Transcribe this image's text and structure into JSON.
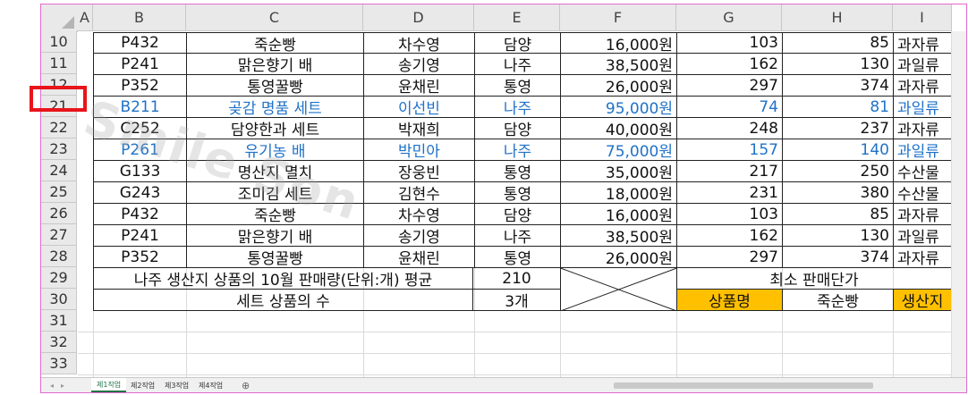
{
  "columns": [
    "A",
    "B",
    "C",
    "D",
    "E",
    "F",
    "G",
    "H",
    "I"
  ],
  "rows": [
    {
      "num": "10",
      "b": "P432",
      "c": "죽순빵",
      "d": "차수영",
      "e": "담양",
      "f": "16,000원",
      "g": "103",
      "h": "85",
      "i": "과자류"
    },
    {
      "num": "11",
      "b": "P241",
      "c": "맑은향기 배",
      "d": "송기영",
      "e": "나주",
      "f": "38,500원",
      "g": "162",
      "h": "130",
      "i": "과일류"
    },
    {
      "num": "12",
      "b": "P352",
      "c": "통영꿀빵",
      "d": "윤채린",
      "e": "통영",
      "f": "26,000원",
      "g": "297",
      "h": "374",
      "i": "과자류"
    },
    {
      "num": "21",
      "b": "B211",
      "c": "곶감 명품 세트",
      "d": "이선빈",
      "e": "나주",
      "f": "95,000원",
      "g": "74",
      "h": "81",
      "i": "과일류",
      "highlight": true
    },
    {
      "num": "22",
      "b": "C252",
      "c": "담양한과 세트",
      "d": "박재희",
      "e": "담양",
      "f": "40,000원",
      "g": "248",
      "h": "237",
      "i": "과자류"
    },
    {
      "num": "23",
      "b": "P261",
      "c": "유기농 배",
      "d": "박민아",
      "e": "나주",
      "f": "75,000원",
      "g": "157",
      "h": "140",
      "i": "과일류",
      "highlight": true
    },
    {
      "num": "24",
      "b": "G133",
      "c": "명산지 멸치",
      "d": "장웅빈",
      "e": "통영",
      "f": "35,000원",
      "g": "217",
      "h": "250",
      "i": "수산물"
    },
    {
      "num": "25",
      "b": "G243",
      "c": "조미김 세트",
      "d": "김현수",
      "e": "통영",
      "f": "18,000원",
      "g": "231",
      "h": "380",
      "i": "수산물"
    },
    {
      "num": "26",
      "b": "P432",
      "c": "죽순빵",
      "d": "차수영",
      "e": "담양",
      "f": "16,000원",
      "g": "103",
      "h": "85",
      "i": "과자류"
    },
    {
      "num": "27",
      "b": "P241",
      "c": "맑은향기 배",
      "d": "송기영",
      "e": "나주",
      "f": "38,500원",
      "g": "162",
      "h": "130",
      "i": "과일류"
    },
    {
      "num": "28",
      "b": "P352",
      "c": "통영꿀빵",
      "d": "윤채린",
      "e": "통영",
      "f": "26,000원",
      "g": "297",
      "h": "374",
      "i": "과자류"
    }
  ],
  "summary": {
    "row29_num": "29",
    "row30_num": "30",
    "avg_label": "나주 생산지 상품의 10월 판매량(단위:개) 평균",
    "avg_value": "210",
    "set_label": "세트 상품의 수",
    "set_value": "3개",
    "min_price_label": "최소 판매단가",
    "product_name_label": "상품명",
    "product_name_value": "죽순빵",
    "origin_label": "생산지"
  },
  "empty_rows": [
    "31",
    "32",
    "33"
  ],
  "watermark": "Smile Son",
  "sheet_tabs": [
    "제1작업",
    "제2작업",
    "제3작업",
    "제4작업"
  ],
  "add_sheet_icon": "plus-circle-icon",
  "colors": {
    "highlight_text": "#1f72c8",
    "gold": "#ffc000",
    "frame": "#e36ad0",
    "red_box": "#e8141b"
  }
}
